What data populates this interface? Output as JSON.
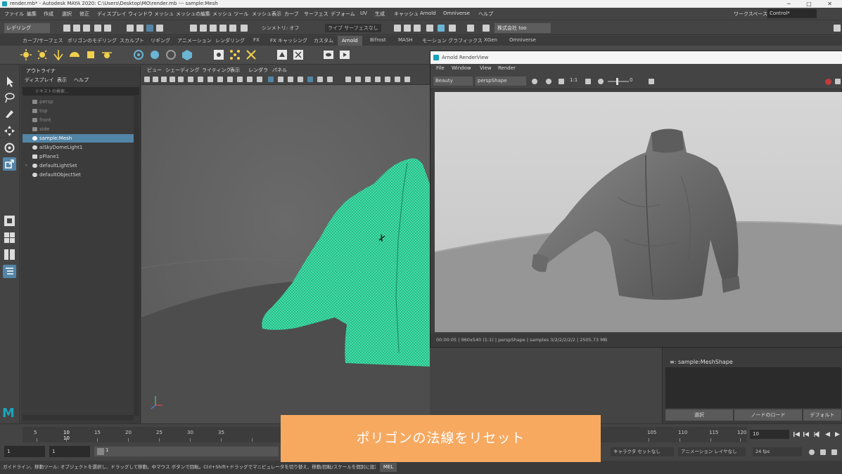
{
  "window": {
    "title": "render.mb* - Autodesk MAYA 2020: C:\\Users\\Desktop\\MO\\render.mb --- sample:Mesh",
    "controls": "─ □ ✕"
  },
  "menubar": {
    "items": [
      "ファイル",
      "編集",
      "作成",
      "選択",
      "修正",
      "ディスプレイ",
      "ウィンドウ",
      "メッシュ",
      "メッシュの編集",
      "メッシュ ツール",
      "メッシュ表示",
      "カーブ",
      "サーフェス",
      "デフォーム",
      "UV",
      "生成",
      "キャッシュ",
      "Arnold",
      "Omniverse",
      "ヘルプ"
    ],
    "workspace_label": "ワークスペース:",
    "workspace_value": "Control*"
  },
  "statusline": {
    "mode": "レデリング",
    "live_target": "ライブ サーフェスなし",
    "symmetry": "シンメトリ: オフ",
    "company": "株式会社 too"
  },
  "shelf_tabs": {
    "items": [
      "カーブ/サーフェス",
      "ポリゴンのモデリング",
      "スカルプト",
      "リギング",
      "アニメーション",
      "レンダリング",
      "FX",
      "FX キャッシング",
      "カスタム",
      "Arnold",
      "Bifrost",
      "MASH",
      "モーション グラフィックス",
      "XGen",
      "Omniverse"
    ],
    "active": "Arnold"
  },
  "outliner": {
    "menu": [
      "ディスプレイ",
      "表示",
      "ヘルプ"
    ],
    "panel_title": "アウトライナ",
    "search_placeholder": "テキストの検索...",
    "rows": [
      {
        "label": "persp",
        "state": "dim"
      },
      {
        "label": "top",
        "state": "dim"
      },
      {
        "label": "front",
        "state": "dim"
      },
      {
        "label": "side",
        "state": "dim"
      },
      {
        "label": "sample:Mesh",
        "state": "sel"
      },
      {
        "label": "aiSkyDomeLight1",
        "state": "normal"
      },
      {
        "label": "pPlane1",
        "state": "normal"
      },
      {
        "label": "defaultLightSet",
        "state": "normal"
      },
      {
        "label": "defaultObjectSet",
        "state": "normal"
      }
    ]
  },
  "viewport": {
    "menu": [
      "ビュー",
      "シェーディング",
      "ライティング",
      "表示",
      "レンダラ",
      "パネル"
    ]
  },
  "render_view": {
    "title": "Arnold RenderView",
    "menu": [
      "File",
      "Window",
      "View",
      "Render"
    ],
    "channel": "Beauty",
    "camera": "perspShape",
    "ratio": "1:1",
    "exposure": "0",
    "status": "00:00:05 | 960x540 (1:1) | perspShape | samples 3/2/2/2/2/2 | 2505.73 MB"
  },
  "attribute_panel": {
    "title": "≡: sample:MeshShape",
    "tabs": [
      "選択",
      "ノードのロード",
      "デフォルト"
    ]
  },
  "timeline": {
    "ticks": [
      "5",
      "10",
      "15",
      "20",
      "25",
      "30",
      "35",
      "105",
      "110",
      "115",
      "120"
    ],
    "current_marker": "10",
    "current_frame": "10"
  },
  "range": {
    "start": "1",
    "start_inner": "1",
    "slider_start": "1",
    "character": "キャラクタ セットなし",
    "anim_layer": "アニメーション レイヤなし",
    "fps": "24 fps"
  },
  "helpline": {
    "text": "ガイドライン、移動ツール: オブジェクトを選択し、ドラッグして移動。中マウス ボタンで回転。Ctrl+Shift+ドラッグでマニピュレータを切り替え、移動/回転/スケールを個別に設定できます。",
    "mel": "MEL"
  },
  "caption": {
    "text": "ポリゴンの法線をリセット"
  },
  "logo": {
    "text": "M"
  },
  "colors": {
    "accent": "#16a2b8",
    "selection": "#5285a6",
    "wireframe": "#3fe0a8",
    "caption_bg": "#f7a960"
  }
}
